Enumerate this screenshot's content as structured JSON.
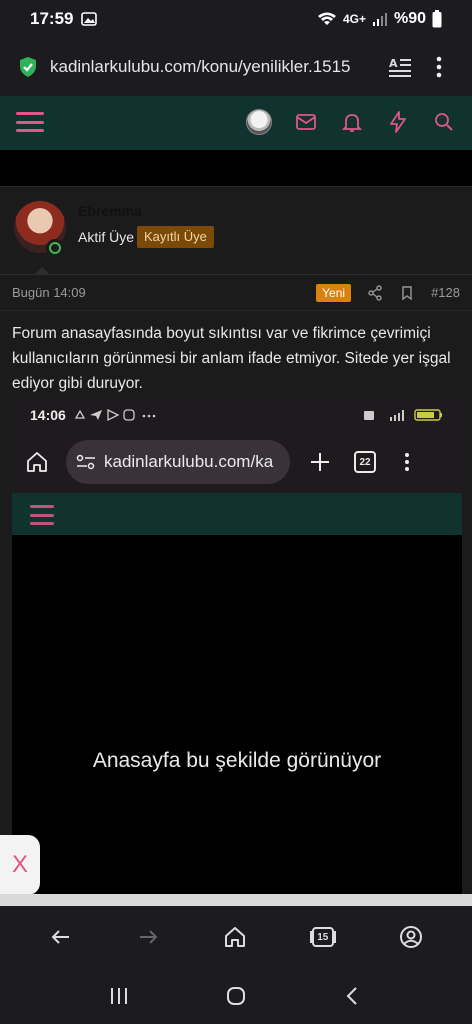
{
  "status_bar": {
    "time": "17:59",
    "battery": "%90",
    "network": "4G+"
  },
  "browser": {
    "url": "kadinlarkulubu.com/konu/yenilikler.1515",
    "tab_count": "15"
  },
  "site_header": {
    "accent_color": "#e0558a",
    "icons": [
      "menu-icon",
      "avatar",
      "mail-icon",
      "bell-icon",
      "bolt-icon",
      "search-icon"
    ]
  },
  "post": {
    "author": {
      "name": "Ebremma",
      "role": "Aktif Üye",
      "badge": "Kayıtlı Üye"
    },
    "date": "Bugün 14:09",
    "new_label": "Yeni",
    "post_number": "#128",
    "body": "Forum anasayfasında boyut sıkıntısı var ve fikrimce çevrimiçi kullanıcıların görünmesi bir anlam ifade etmiyor. Sitede yer işgal ediyor gibi duruyor."
  },
  "embedded_screenshot": {
    "time": "14:06",
    "url": "kadinlarkulubu.com/ka",
    "tab_count": "22",
    "caption": "Anasayfa bu şekilde görünüyor"
  },
  "floating_close": {
    "label": "X"
  }
}
